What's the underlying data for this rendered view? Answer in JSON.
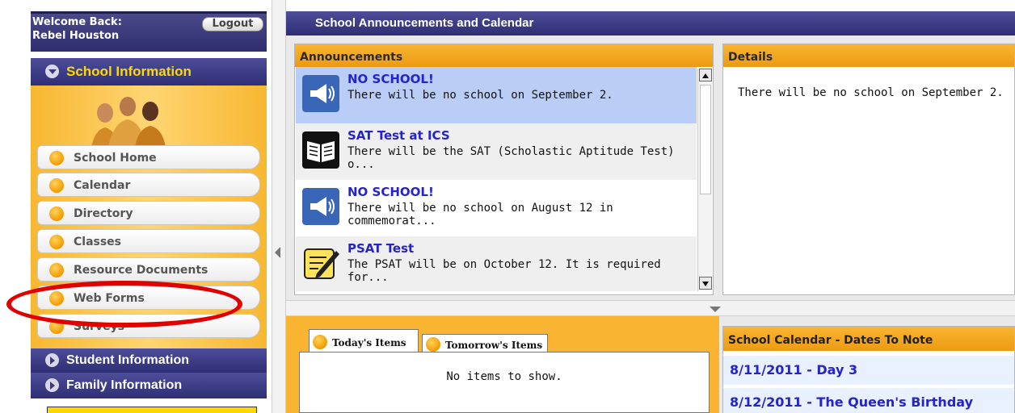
{
  "sidebar": {
    "welcome_line1": "Welcome Back:",
    "welcome_line2": "Rebel Houston",
    "logout_label": "Logout",
    "school_info_header": "School Information",
    "nav_items": [
      {
        "label": "School Home"
      },
      {
        "label": "Calendar"
      },
      {
        "label": "Directory"
      },
      {
        "label": "Classes"
      },
      {
        "label": "Resource Documents"
      },
      {
        "label": "Web Forms"
      },
      {
        "label": "Surveys"
      }
    ],
    "student_info_header": "Student Information",
    "family_info_header": "Family Information"
  },
  "main": {
    "title": "School Announcements and Calendar",
    "announcements_header": "Announcements",
    "announcements": [
      {
        "title": "NO SCHOOL!",
        "desc": "There will be no school on September 2.",
        "icon": "megaphone-icon",
        "selected": true
      },
      {
        "title": "SAT Test at ICS",
        "desc": "There will be the SAT (Scholastic Aptitude Test) o...",
        "icon": "book-icon",
        "selected": false
      },
      {
        "title": "NO SCHOOL!",
        "desc": "There will be no school on August 12 in commemorat...",
        "icon": "megaphone-icon",
        "selected": false
      },
      {
        "title": "PSAT Test",
        "desc": "The PSAT will be on October 12. It is required for...",
        "icon": "pencil-note-icon",
        "selected": false
      }
    ],
    "details_header": "Details",
    "details_text": "There will be no school on September 2.",
    "tabs": [
      {
        "label": "Today's Items",
        "active": true
      },
      {
        "label": "Tomorrow's Items",
        "active": false
      }
    ],
    "no_items_text": "No items to show.",
    "calendar_header": "School Calendar - Dates To Note",
    "calendar_items": [
      {
        "label": "8/11/2011 - Day 3"
      },
      {
        "label": "8/12/2011 - The Queen's Birthday"
      }
    ]
  },
  "colors": {
    "nav_blue": "#2f2f75",
    "accent_orange": "#f9b531",
    "link_blue": "#2424c8",
    "highlight_red": "#e00000"
  }
}
